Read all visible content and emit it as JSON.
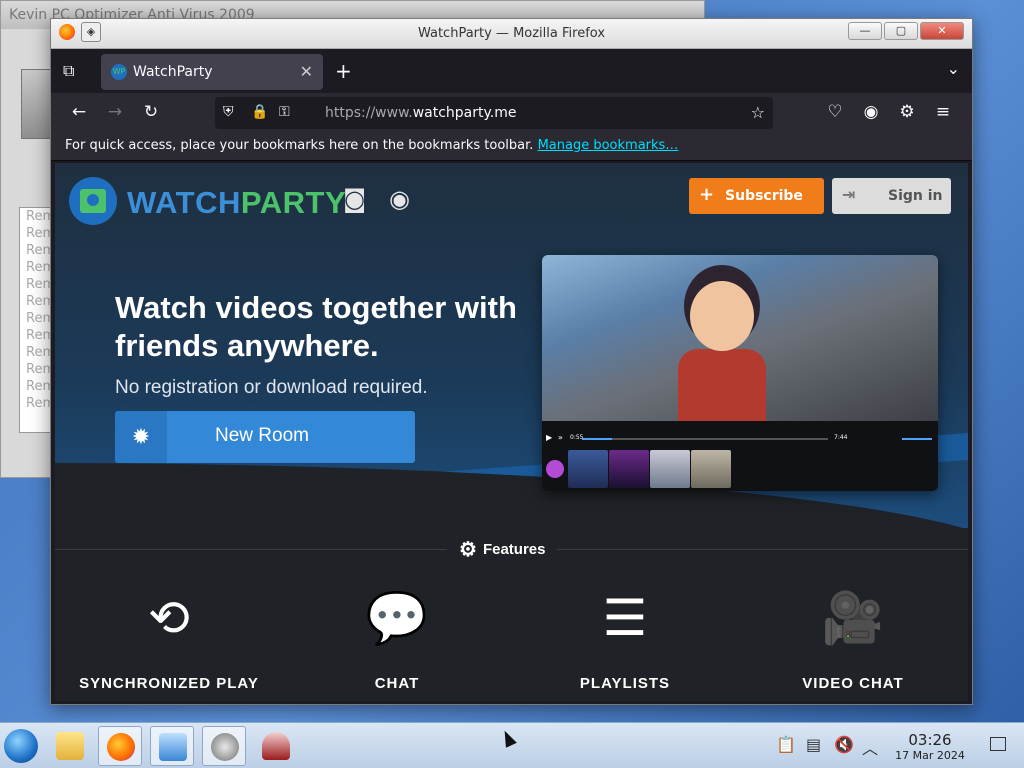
{
  "background_window": {
    "title": "Kevin PC Optimizer Anti Virus 2009",
    "list_items": [
      "Rem",
      "Rem",
      "Rem",
      "Rem",
      "Rem",
      "Rem",
      "Rem",
      "Rem",
      "Rem",
      "Rem",
      "Rem",
      "Rem"
    ]
  },
  "window": {
    "title": "WatchParty — Mozilla Firefox",
    "pin_glyph": "◈",
    "min_glyph": "—",
    "max_glyph": "▢",
    "close_glyph": "✕"
  },
  "tabs": [
    {
      "label": "WatchParty",
      "favicon": "WP",
      "close": "✕"
    }
  ],
  "tabbar": {
    "list_glyph": "⧉",
    "new_tab_glyph": "+",
    "menu_glyph": "⌄"
  },
  "navbar": {
    "back": "←",
    "forward": "→",
    "reload": "↻",
    "url_prefix": "https://www.",
    "url_domain": "watchparty.me",
    "icons": {
      "shield": "⛨",
      "lock": "🔒",
      "perm": "⚿",
      "bookmark_star": "☆",
      "pocket": "♡",
      "account": "◉",
      "extensions": "⚙",
      "menu": "≡"
    }
  },
  "bookmarks_bar": {
    "text": "For quick access, place your bookmarks here on the bookmarks toolbar.",
    "link": "Manage bookmarks…"
  },
  "page": {
    "brand_watch": "WATCH",
    "brand_party": "PARTY",
    "discord_glyph": "◙",
    "github_glyph": "◉",
    "subscribe": {
      "icon": "+",
      "label": "Subscribe"
    },
    "signin": {
      "icon": "⇥",
      "label": "Sign in"
    },
    "headline": "Watch videos together with friends anywhere.",
    "subheadline": "No registration or download required.",
    "new_room": {
      "icon": "✹",
      "label": "New Room"
    },
    "preview": {
      "time_elapsed": "0:55",
      "time_total": "7:44",
      "play_glyph": "▶",
      "skip_glyph": "»"
    },
    "features_title": "Features",
    "features_icon": "⚙",
    "features": [
      {
        "icon": "⟲",
        "label": "SYNCHRONIZED PLAY"
      },
      {
        "icon": "💬",
        "label": "CHAT"
      },
      {
        "icon": "☰",
        "label": "PLAYLISTS"
      },
      {
        "icon": "🎥",
        "label": "VIDEO CHAT"
      }
    ]
  },
  "taskbar": {
    "time": "03:26",
    "date": "17 Mar 2024",
    "tray": {
      "clipboard": "📋",
      "battery": "▤",
      "volume": "🔇",
      "chevron": "︿"
    }
  },
  "colors": {
    "accent_blue": "#3b8fd6",
    "accent_green": "#4cc36a",
    "subscribe_orange": "#f07c1a",
    "new_room_blue": "#3488d8",
    "link_cyan": "#00ddff"
  }
}
